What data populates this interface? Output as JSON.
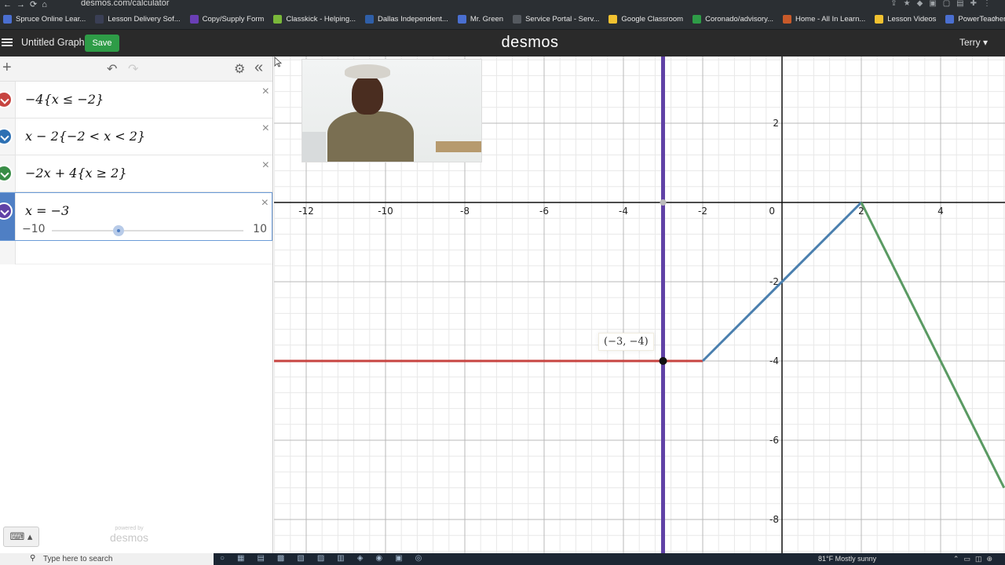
{
  "browser": {
    "url": "desmos.com/calculator",
    "bookmarks": [
      {
        "label": "Spruce Online Lear...",
        "color": "#4a6fd1"
      },
      {
        "label": "Lesson Delivery Sof...",
        "color": "#3a3f55"
      },
      {
        "label": "Copy/Supply Form",
        "color": "#6a3fb5"
      },
      {
        "label": "Classkick - Helping...",
        "color": "#7ab83a"
      },
      {
        "label": "Dallas Independent...",
        "color": "#2f5fa8"
      },
      {
        "label": "Mr. Green",
        "color": "#4a6fd1"
      },
      {
        "label": "Service Portal - Serv...",
        "color": "#555a60"
      },
      {
        "label": "Google Classroom",
        "color": "#f2c230"
      },
      {
        "label": "Coronado/advisory...",
        "color": "#2e9c47"
      },
      {
        "label": "Home - All In Learn...",
        "color": "#c85a2a"
      },
      {
        "label": "Lesson Videos",
        "color": "#f2c230"
      },
      {
        "label": "PowerTeacher",
        "color": "#4a6fd1"
      }
    ],
    "more": "»"
  },
  "header": {
    "title": "Untitled Graph",
    "save_label": "Save",
    "logo": "desmos",
    "user": "Terry ▾"
  },
  "toolbar": {
    "add_icon": "+",
    "undo_icon": "↶",
    "redo_icon": "↷",
    "settings_icon": "⚙",
    "collapse_icon": "«"
  },
  "expressions": [
    {
      "latex": "−4{x ≤ −2}",
      "color": "#c74440"
    },
    {
      "latex": "x − 2{−2 < x < 2}",
      "color": "#2d70b3"
    },
    {
      "latex": "−2x + 4{x ≥ 2}",
      "color": "#388c46"
    },
    {
      "latex": "x = −3",
      "color": "#6042a6",
      "slider": {
        "min": "−10",
        "max": "10",
        "value": -3
      }
    }
  ],
  "close_icon": "×",
  "keyboard_icon": "⌨ ▴",
  "powered_by": {
    "small": "powered by",
    "big": "desmos"
  },
  "graph": {
    "x_ticks": [
      "-12",
      "-10",
      "-8",
      "-6",
      "-4",
      "-2",
      "0",
      "2",
      "4"
    ],
    "y_ticks": [
      "2",
      "-2",
      "-4",
      "-6",
      "-8"
    ],
    "point_label": "(−3, −4)",
    "colors": {
      "red": "#c74440",
      "blue": "#4a7fae",
      "green": "#5a9a63",
      "purple": "#6042a6",
      "grid_minor": "#e8e8e8",
      "grid_major": "#b8b8b8",
      "axis": "#111111"
    }
  },
  "taskbar": {
    "search_placeholder": "Type here to search",
    "weather": "81°F  Mostly sunny"
  }
}
